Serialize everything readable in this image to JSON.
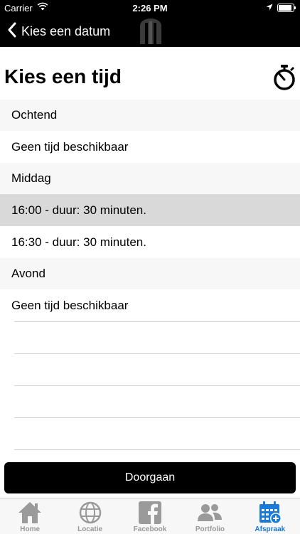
{
  "status_bar": {
    "carrier": "Carrier",
    "time": "2:26 PM",
    "battery_level": 1.0
  },
  "nav": {
    "back_label": "Kies een datum"
  },
  "page": {
    "title": "Kies een tijd"
  },
  "sections": [
    {
      "header": "Ochtend",
      "rows": [
        "Geen tijd beschikbaar"
      ]
    },
    {
      "header": "Middag",
      "rows": [
        "16:00 - duur: 30 minuten.",
        "16:30 - duur: 30 minuten."
      ]
    },
    {
      "header": "Avond",
      "rows": [
        "Geen tijd beschikbaar"
      ]
    }
  ],
  "selected_row": "16:00 - duur: 30 minuten.",
  "continue_button": {
    "label": "Doorgaan"
  },
  "tabs": [
    {
      "label": "Home",
      "icon": "home-icon"
    },
    {
      "label": "Locatie",
      "icon": "globe-icon"
    },
    {
      "label": "Facebook",
      "icon": "facebook-icon"
    },
    {
      "label": "Portfolio",
      "icon": "people-icon"
    },
    {
      "label": "Afspraak",
      "icon": "calendar-add-icon",
      "active": true
    }
  ],
  "colors": {
    "accent": "#1a7ad9",
    "bar_background": "#000000",
    "selected_row": "#d9d9d9",
    "section_header": "#f7f7f7"
  }
}
